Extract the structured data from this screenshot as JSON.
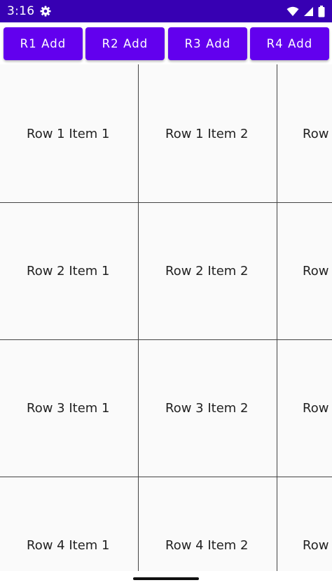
{
  "status_bar": {
    "time": "3:16",
    "settings_icon": "gear-icon",
    "wifi_icon": "wifi-icon",
    "signal_icon": "cell-signal-icon",
    "battery_icon": "battery-icon",
    "color": "#3700b3"
  },
  "buttons": [
    {
      "label": "R1 Add"
    },
    {
      "label": "R2 Add"
    },
    {
      "label": "R3 Add"
    },
    {
      "label": "R4 Add"
    }
  ],
  "button_color": "#6200ee",
  "grid": {
    "rows": [
      {
        "items": [
          "Row 1 Item 1",
          "Row 1 Item 2",
          "Row"
        ]
      },
      {
        "items": [
          "Row 2 Item 1",
          "Row 2 Item 2",
          "Row"
        ]
      },
      {
        "items": [
          "Row 3 Item 1",
          "Row 3 Item 2",
          "Row"
        ]
      },
      {
        "items": [
          "Row 4 Item 1",
          "Row 4 Item 2",
          "Row"
        ]
      }
    ]
  }
}
